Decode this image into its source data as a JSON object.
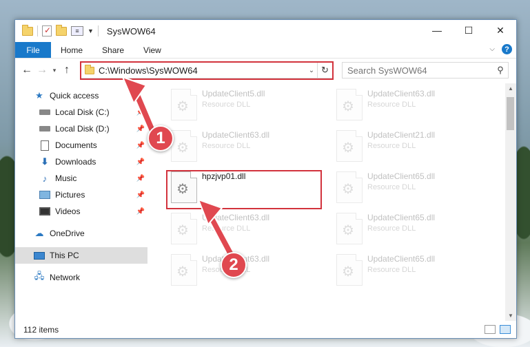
{
  "window": {
    "title": "SysWOW64",
    "minimize_glyph": "—",
    "maximize_glyph": "☐",
    "close_glyph": "✕"
  },
  "ribbon": {
    "tabs": [
      "File",
      "Home",
      "Share",
      "View"
    ],
    "help_glyph": "?"
  },
  "navbar": {
    "back_glyph": "←",
    "forward_glyph": "→",
    "recent_glyph": "▾",
    "up_glyph": "↑",
    "address": "C:\\Windows\\SysWOW64",
    "address_dropdown_glyph": "⌄",
    "refresh_glyph": "↻",
    "search_placeholder": "Search SysWOW64"
  },
  "sidebar": {
    "items": [
      {
        "label": "Quick access",
        "icon": "star-icon",
        "pinned": false
      },
      {
        "label": "Local Disk (C:)",
        "icon": "disk-icon",
        "pinned": true
      },
      {
        "label": "Local Disk (D:)",
        "icon": "disk-icon",
        "pinned": true
      },
      {
        "label": "Documents",
        "icon": "documents-icon",
        "pinned": true
      },
      {
        "label": "Downloads",
        "icon": "download-icon",
        "pinned": true
      },
      {
        "label": "Music",
        "icon": "music-icon",
        "pinned": true
      },
      {
        "label": "Pictures",
        "icon": "pictures-icon",
        "pinned": true
      },
      {
        "label": "Videos",
        "icon": "videos-icon",
        "pinned": true
      },
      {
        "label": "OneDrive",
        "icon": "cloud-icon",
        "pinned": false
      },
      {
        "label": "This PC",
        "icon": "pc-icon",
        "pinned": false,
        "selected": true
      },
      {
        "label": "Network",
        "icon": "network-icon",
        "pinned": false
      }
    ]
  },
  "files": [
    {
      "name": "UpdateClient5.dll",
      "type": "Resource DLL",
      "faded": true
    },
    {
      "name": "UpdateClient63.dll",
      "type": "Resource DLL",
      "faded": true
    },
    {
      "name": "UpdateClient63.dll",
      "type": "Resource DLL",
      "faded": true
    },
    {
      "name": "UpdateClient21.dll",
      "type": "Resource DLL",
      "faded": true
    },
    {
      "name": "hpzjvp01.dll",
      "type": "",
      "faded": false
    },
    {
      "name": "UpdateClient65.dll",
      "type": "Resource DLL",
      "faded": true
    },
    {
      "name": "UpdateClient63.dll",
      "type": "Resource DLL",
      "faded": true
    },
    {
      "name": "UpdateClient65.dll",
      "type": "Resource DLL",
      "faded": true
    },
    {
      "name": "UpdateClient63.dll",
      "type": "Resource DLL",
      "faded": true
    },
    {
      "name": "UpdateClient65.dll",
      "type": "Resource DLL",
      "faded": true
    }
  ],
  "status": {
    "item_count": "112 items"
  },
  "callouts": [
    "1",
    "2"
  ],
  "colors": {
    "accent": "#1979ca",
    "highlight": "#d2323c",
    "callout": "#e04850"
  }
}
